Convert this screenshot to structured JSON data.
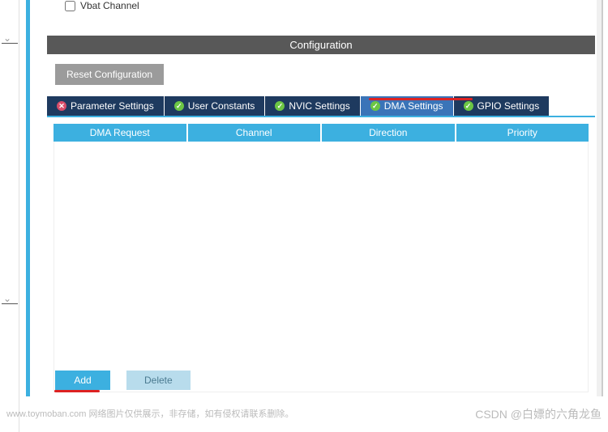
{
  "checkbox": {
    "label": "Vbat Channel"
  },
  "config_header": "Configuration",
  "reset_btn": "Reset Configuration",
  "tabs": [
    {
      "label": "Parameter Settings",
      "status": "err"
    },
    {
      "label": "User Constants",
      "status": "ok"
    },
    {
      "label": "NVIC Settings",
      "status": "ok"
    },
    {
      "label": "DMA Settings",
      "status": "ok",
      "active": true
    },
    {
      "label": "GPIO Settings",
      "status": "ok"
    }
  ],
  "columns": [
    "DMA Request",
    "Channel",
    "Direction",
    "Priority"
  ],
  "actions": {
    "add": "Add",
    "delete": "Delete"
  },
  "watermark_left": "www.toymoban.com 网络图片仅供展示，非存储，如有侵权请联系删除。",
  "watermark_right": "CSDN @白嫖的六角龙鱼"
}
